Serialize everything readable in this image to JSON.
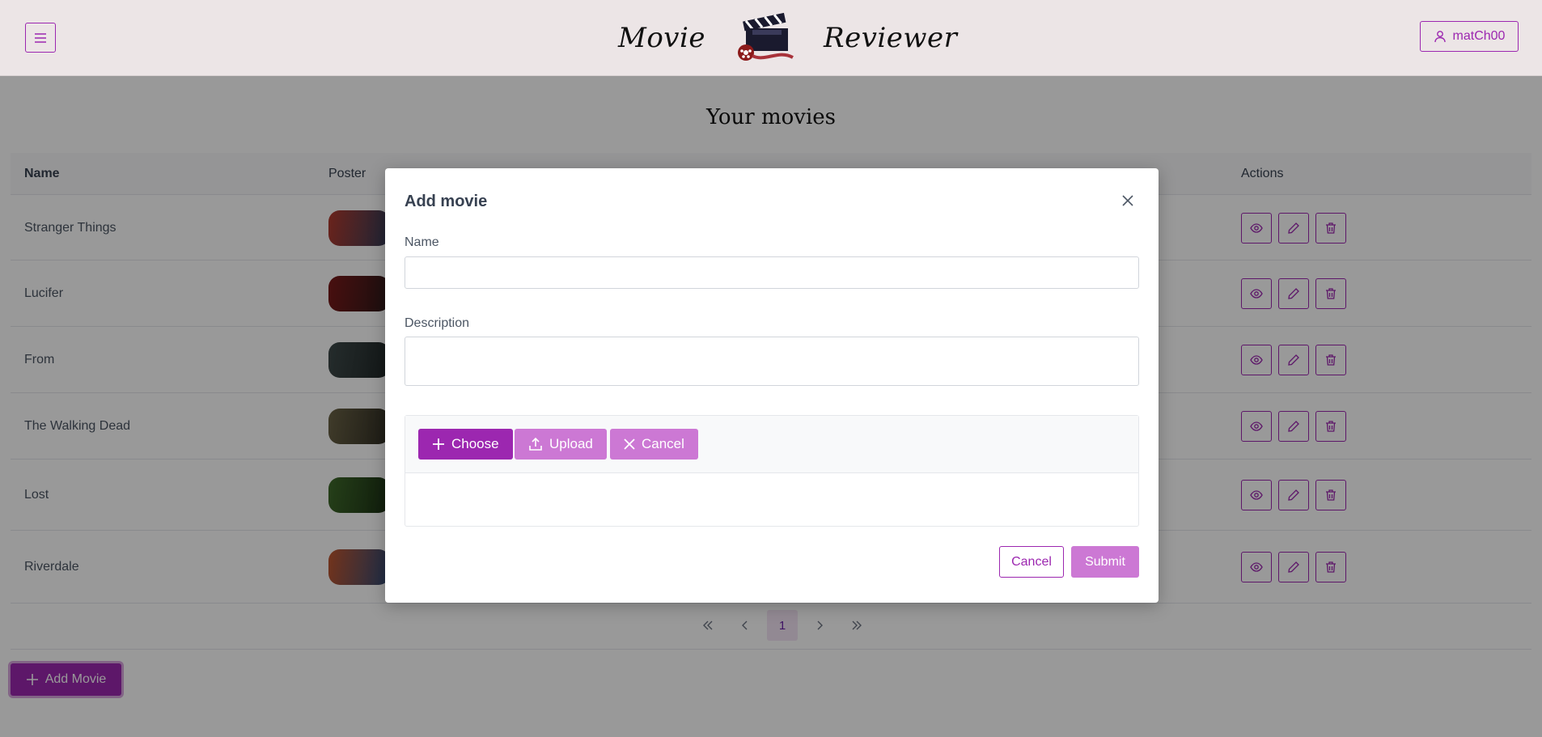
{
  "header": {
    "brand_left": "Movie",
    "brand_right": "Reviewer",
    "username": "matCh00"
  },
  "main": {
    "title": "Your movies",
    "columns": {
      "name": "Name",
      "poster": "Poster",
      "actions": "Actions"
    },
    "rows": [
      {
        "name": "Stranger Things",
        "poster_colors": [
          "#b23b2e",
          "#2f3c5a"
        ]
      },
      {
        "name": "Lucifer",
        "poster_colors": [
          "#7a1a1a",
          "#2a1a1a"
        ]
      },
      {
        "name": "From",
        "poster_colors": [
          "#3e4a4a",
          "#1f2626"
        ]
      },
      {
        "name": "The Walking Dead",
        "poster_colors": [
          "#6b6346",
          "#2d2b22"
        ]
      },
      {
        "name": "Lost",
        "poster_colors": [
          "#3f6b2a",
          "#1a2e14"
        ]
      },
      {
        "name": "Riverdale",
        "poster_colors": [
          "#c0562e",
          "#2c4a78"
        ]
      }
    ],
    "pagination": {
      "current_page": "1"
    },
    "add_button": "Add Movie"
  },
  "dialog": {
    "title": "Add movie",
    "name_label": "Name",
    "name_value": "",
    "description_label": "Description",
    "description_value": "",
    "choose_label": "Choose",
    "upload_label": "Upload",
    "upload_cancel_label": "Cancel",
    "cancel_label": "Cancel",
    "submit_label": "Submit"
  },
  "colors": {
    "accent": "#9c27b0",
    "accent_light": "#cc78d4",
    "header_bg": "#ece5e6"
  },
  "icons": [
    "menu-icon",
    "clapperboard-logo",
    "user-icon",
    "eye-icon",
    "pencil-icon",
    "trash-icon",
    "close-icon",
    "plus-icon",
    "upload-icon",
    "x-icon",
    "chevrons-left-icon",
    "chevron-left-icon",
    "chevron-right-icon",
    "chevrons-right-icon"
  ]
}
